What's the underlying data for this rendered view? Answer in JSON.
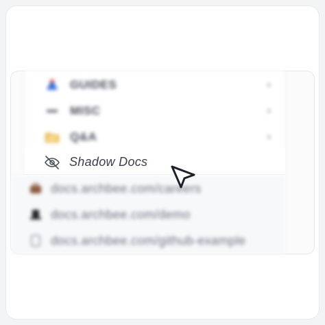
{
  "nav": {
    "items": [
      {
        "label": "GUIDES",
        "icon": "flask-icon",
        "chevron": "›"
      },
      {
        "label": "MISC",
        "icon": "minus-icon",
        "chevron": "›"
      },
      {
        "label": "Q&A",
        "icon": "folder-icon",
        "chevron": "›"
      }
    ]
  },
  "shadow": {
    "label": "Shadow Docs",
    "icon": "eye-off-icon"
  },
  "links": [
    {
      "label": "docs.archbee.com/careers",
      "icon": "briefcase-icon"
    },
    {
      "label": "docs.archbee.com/demo",
      "icon": "hat-icon"
    },
    {
      "label": "docs.archbee.com/github-example",
      "icon": "document-icon"
    }
  ],
  "colors": {
    "accent_blue": "#3b6fd8",
    "accent_red": "#e2533d",
    "folder": "#e7b54a",
    "text": "#3b3f4a"
  }
}
